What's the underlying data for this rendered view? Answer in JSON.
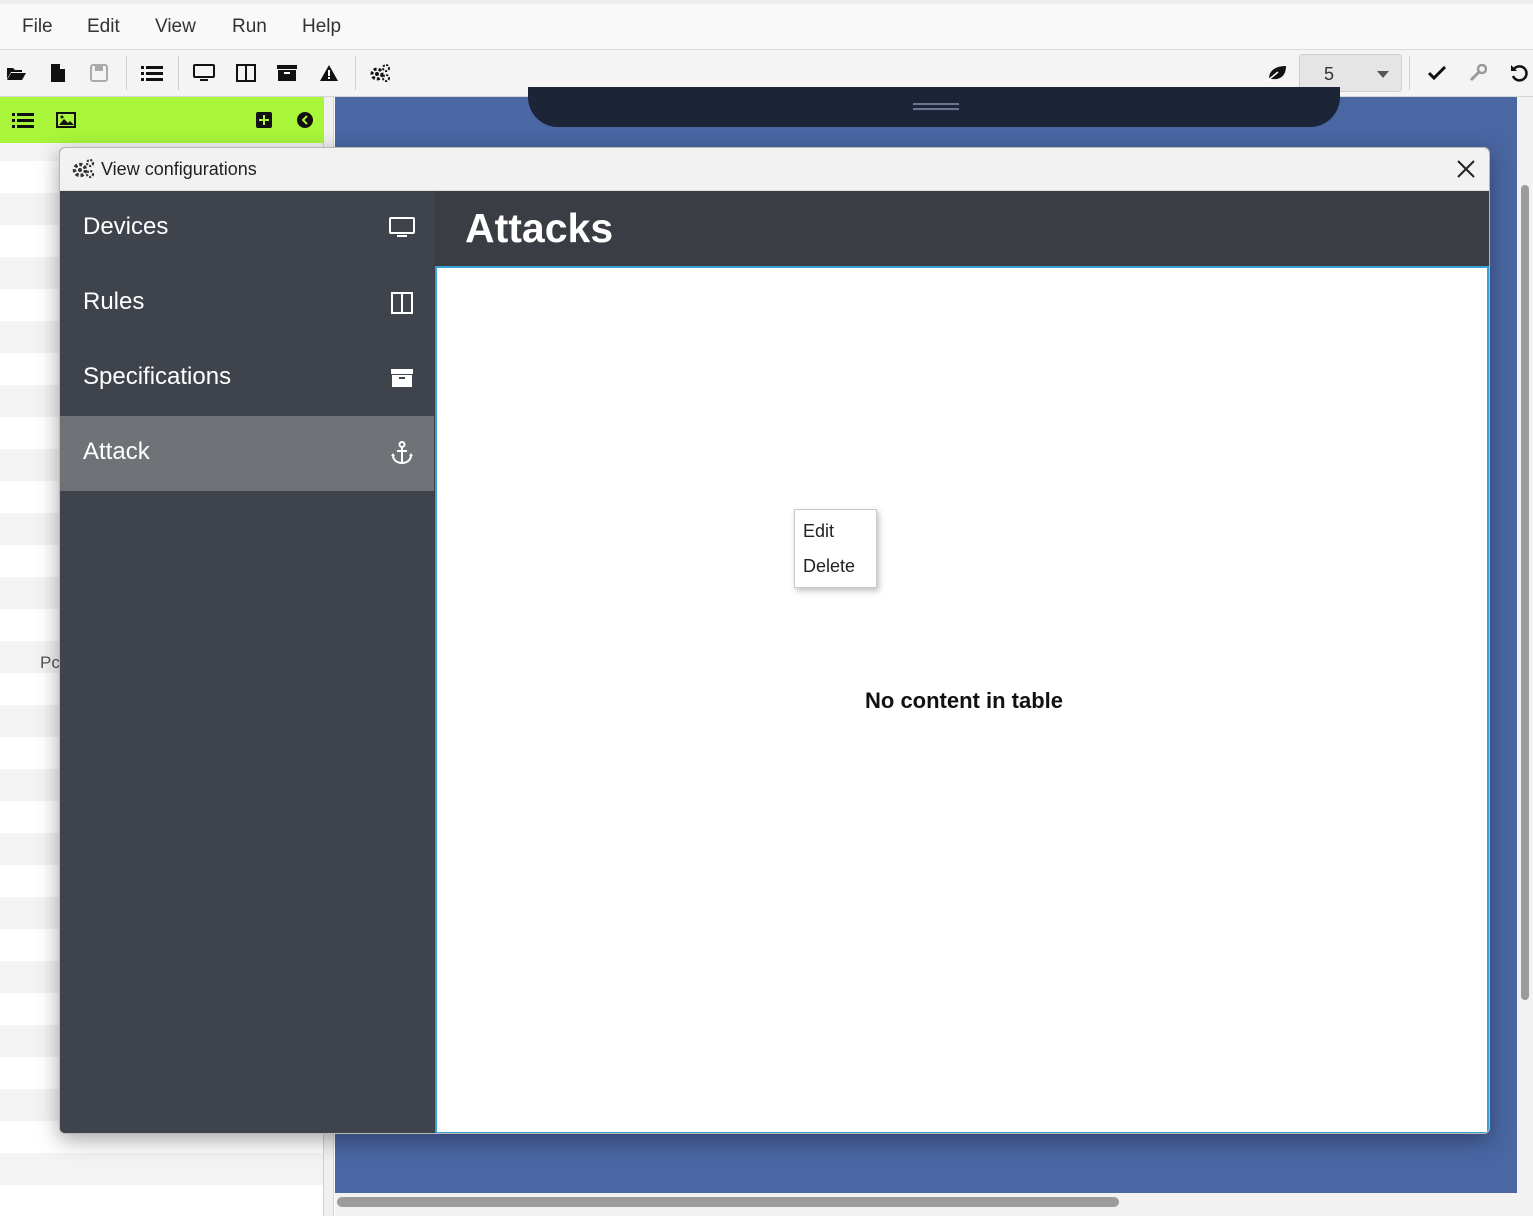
{
  "menu": {
    "items": [
      {
        "label": "File"
      },
      {
        "label": "Edit"
      },
      {
        "label": "View"
      },
      {
        "label": "Run"
      },
      {
        "label": "Help"
      }
    ]
  },
  "toolbar": {
    "left_icons": [
      "folder-open-icon",
      "new-file-icon",
      "save-icon",
      "list-icon",
      "monitor-icon",
      "columns-icon",
      "archive-icon",
      "warning-icon",
      "gears-icon"
    ],
    "zoom_value": "5",
    "right_icons": [
      "leaf-icon",
      "check-icon",
      "wrench-icon",
      "undo-icon"
    ]
  },
  "left_panel": {
    "header_icons": [
      "list-icon",
      "image-icon",
      "plus-square-icon",
      "chevron-left-circle-icon"
    ],
    "accent_color": "#a8f53a",
    "partial_label": "Pc"
  },
  "dialog": {
    "title": "View configurations",
    "nav": [
      {
        "label": "Devices",
        "icon": "monitor-icon",
        "active": false
      },
      {
        "label": "Rules",
        "icon": "columns-icon",
        "active": false
      },
      {
        "label": "Specifications",
        "icon": "archive-icon",
        "active": false
      },
      {
        "label": "Attack",
        "icon": "anchor-icon",
        "active": true
      }
    ],
    "content_title": "Attacks",
    "empty_message": "No content in table",
    "context_menu": [
      "Edit",
      "Delete"
    ]
  },
  "colors": {
    "canvas": "#4a66a3",
    "dialog_bg": "#3f434b",
    "nav_active": "#6f7276",
    "table_border": "#35a3d6"
  }
}
